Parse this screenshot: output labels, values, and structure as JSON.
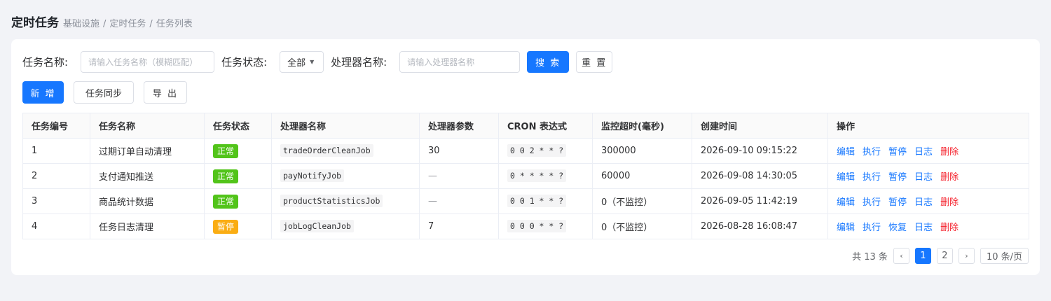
{
  "header": {
    "title": "定时任务",
    "breadcrumb": [
      "基础设施",
      "定时任务",
      "任务列表"
    ],
    "breadcrumb_sep": "/"
  },
  "search": {
    "task_name_label": "任务名称:",
    "task_name_placeholder": "请输入任务名称（模糊匹配）",
    "status_label": "任务状态:",
    "status_value": "全部",
    "handler_label": "处理器名称:",
    "handler_placeholder": "请输入处理器名称",
    "search_button": "搜 索",
    "reset_button": "重 置"
  },
  "actions": {
    "add_button": "新 增",
    "sync_button": "任务同步",
    "export_button": "导 出"
  },
  "table": {
    "columns": [
      "任务编号",
      "任务名称",
      "任务状态",
      "处理器名称",
      "处理器参数",
      "CRON 表达式",
      "监控超时(毫秒)",
      "创建时间",
      "操作"
    ],
    "rows": [
      {
        "id": "1",
        "name": "过期订单自动清理",
        "status": "正常",
        "status_color": "#52c41a",
        "handler": "tradeOrderCleanJob",
        "param": "30",
        "cron": "0 0 2 * * ?",
        "timeout": "300000",
        "created": "2026-09-10 09:15:22",
        "ops": [
          "编辑",
          "执行",
          "暂停",
          "日志",
          "删除"
        ]
      },
      {
        "id": "2",
        "name": "支付通知推送",
        "status": "正常",
        "status_color": "#52c41a",
        "handler": "payNotifyJob",
        "param": "—",
        "cron": "0 * * * * ?",
        "timeout": "60000",
        "created": "2026-09-08 14:30:05",
        "ops": [
          "编辑",
          "执行",
          "暂停",
          "日志",
          "删除"
        ]
      },
      {
        "id": "3",
        "name": "商品统计数据",
        "status": "正常",
        "status_color": "#52c41a",
        "handler": "productStatisticsJob",
        "param": "—",
        "cron": "0 0 1 * * ?",
        "timeout": "0（不监控）",
        "created": "2026-09-05 11:42:19",
        "ops": [
          "编辑",
          "执行",
          "暂停",
          "日志",
          "删除"
        ]
      },
      {
        "id": "4",
        "name": "任务日志清理",
        "status": "暂停",
        "status_color": "#faad14",
        "handler": "jobLogCleanJob",
        "param": "7",
        "cron": "0 0 0 * * ?",
        "timeout": "0（不监控）",
        "created": "2026-08-28 16:08:47",
        "ops": [
          "编辑",
          "执行",
          "恢复",
          "日志",
          "删除"
        ]
      }
    ]
  },
  "pagination": {
    "total_text": "共 13 条",
    "prev": "‹",
    "pages": [
      "1",
      "2"
    ],
    "current_page": "1",
    "next": "›",
    "page_size": "10 条/页"
  }
}
